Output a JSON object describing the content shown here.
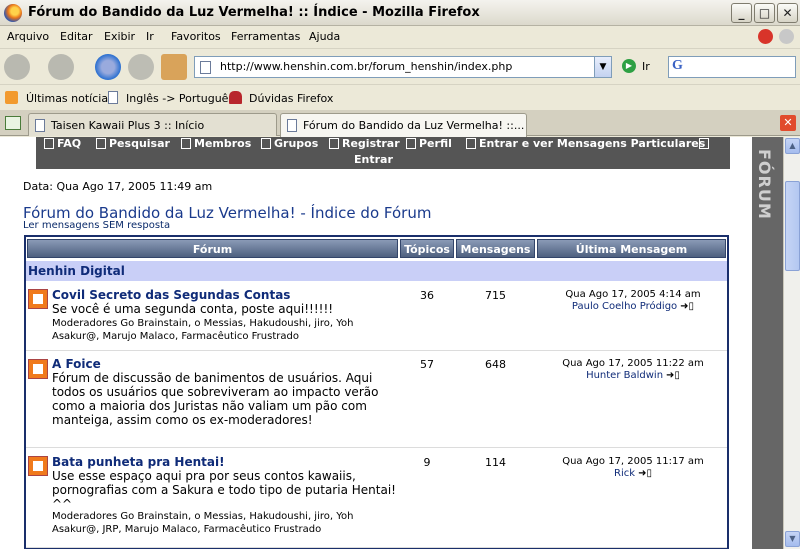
{
  "window": {
    "title": "Fórum do Bandido da Luz Vermelha! :: Índice - Mozilla Firefox",
    "minimize_glyph": "_",
    "maximize_glyph": "□",
    "close_glyph": "✕"
  },
  "menu": [
    "Arquivo",
    "Editar",
    "Exibir",
    "Ir",
    "Favoritos",
    "Ferramentas",
    "Ajuda"
  ],
  "toolbar": {
    "url": "http://www.henshin.com.br/forum_henshin/index.php",
    "dropdown_glyph": "▼",
    "go_glyph": "▶",
    "go_label": "Ir",
    "search_logo": "G"
  },
  "bookmarks": [
    "Últimas notícias",
    "Inglês -> Português",
    "Dúvidas Firefox"
  ],
  "tabs": [
    {
      "label": "Taisen Kawaii Plus 3 :: Início",
      "active": false
    },
    {
      "label": "Fórum do Bandido da Luz Vermelha! ::...",
      "active": true
    }
  ],
  "tab_close_glyph": "✕",
  "forum_nav": {
    "items": [
      "FAQ",
      "Pesquisar",
      "Membros",
      "Grupos",
      "Registrar",
      "Perfil",
      "Entrar e ver Mensagens Particulares"
    ],
    "login": "Entrar"
  },
  "side_banner": "FÓRUM",
  "page": {
    "date": "Data: Qua Ago 17, 2005 11:49 am",
    "title": "Fórum do Bandido da Luz Vermelha! - Índice do Fórum",
    "unanswered": "Ler mensagens SEM resposta"
  },
  "table": {
    "headers": [
      "Fórum",
      "Tópicos",
      "Mensagens",
      "Última Mensagem"
    ],
    "category": "Henhin Digital",
    "go_glyph": "➜▯",
    "forums": [
      {
        "name": "Covil Secreto das Segundas Contas",
        "desc": "Se você é uma segunda conta, poste aqui!!!!!!",
        "mods": "Moderadores Go Brainstain, o Messias, Hakudoushi, jiro, Yoh Asakur@, Marujo Malaco, Farmacêutico Frustrado",
        "topics": "36",
        "posts": "715",
        "last_date": "Qua Ago 17, 2005 4:14 am",
        "last_user": "Paulo Coelho Pródigo"
      },
      {
        "name": "A Foice",
        "desc": "Fórum de discussão de banimentos de usuários. Aqui todos os usuários que sobreviveram ao impacto verão como a maioria dos Juristas não valiam um pão com manteiga, assim como os ex-moderadores!",
        "mods": "",
        "topics": "57",
        "posts": "648",
        "last_date": "Qua Ago 17, 2005 11:22 am",
        "last_user": "Hunter Baldwin"
      },
      {
        "name": "Bata punheta pra Hentai!",
        "desc": "Use esse espaço aqui pra por seus contos kawaiis, pornografias com a Sakura e todo tipo de putaria Hentai! ^^",
        "mods": "Moderadores Go Brainstain, o Messias, Hakudoushi, jiro, Yoh Asakur@, JRP, Marujo Malaco, Farmacêutico Frustrado",
        "topics": "9",
        "posts": "114",
        "last_date": "Qua Ago 17, 2005 11:17 am",
        "last_user": "Rick"
      }
    ]
  },
  "scrollbar": {
    "up_glyph": "▲",
    "down_glyph": "▼"
  },
  "colors": {
    "accent": "#1a3a8c",
    "category_bg": "#c9cff7",
    "nav_bg": "#555555"
  }
}
